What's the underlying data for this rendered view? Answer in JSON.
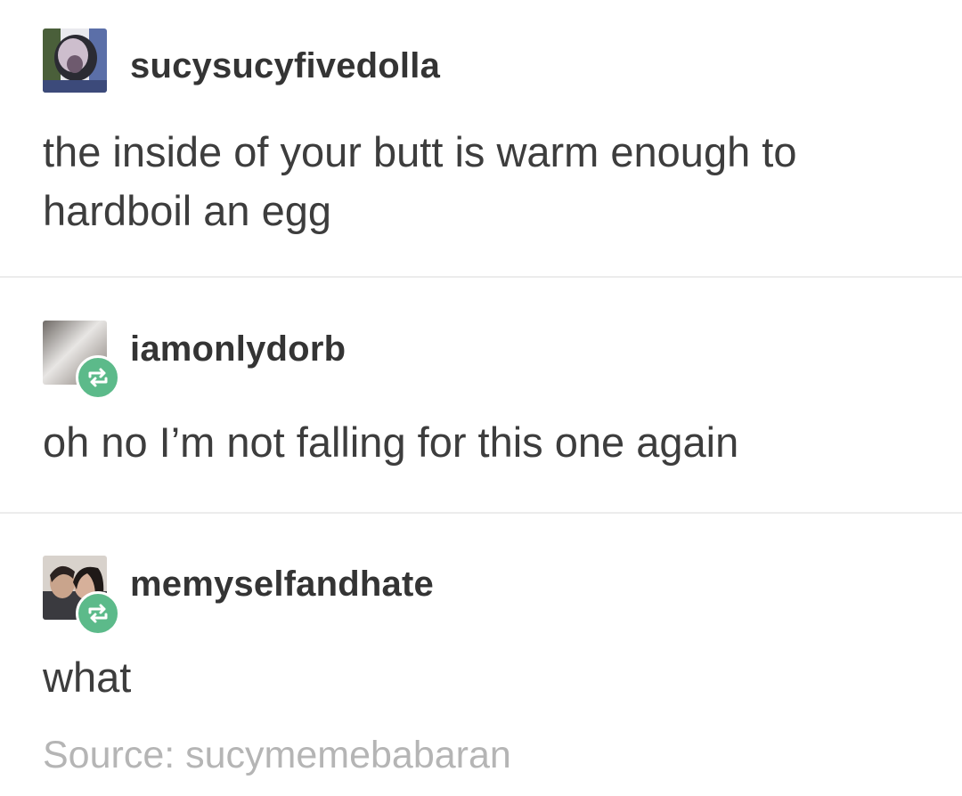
{
  "posts": [
    {
      "username": "sucysucyfivedolla",
      "text": "the inside of your butt is warm enough to hardboil an egg",
      "reblog": false
    },
    {
      "username": "iamonlydorb",
      "text": "oh no I’m not falling for this one again",
      "reblog": true
    },
    {
      "username": "memyselfandhate",
      "text": "what",
      "reblog": true
    }
  ],
  "source": {
    "label": "Source: sucymemebabaran"
  },
  "icons": {
    "reblog": "reblog-icon",
    "avatar": "avatar"
  },
  "colors": {
    "reblog_badge": "#5cba8a",
    "text": "#3d3d3d",
    "source_text": "#b5b5b5",
    "divider": "#ececec"
  }
}
